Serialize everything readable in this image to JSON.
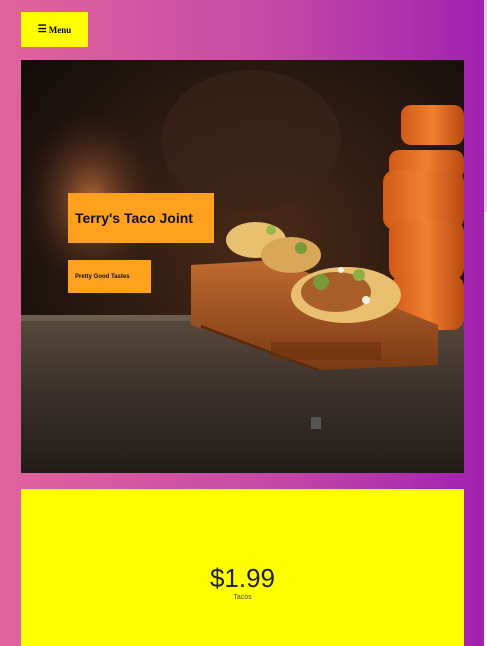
{
  "nav": {
    "menu_icon": "☰",
    "menu_label": "Menu"
  },
  "hero": {
    "title": "Terry's Taco Joint",
    "tagline": "Pretty Good Tastes",
    "image": "tacos-on-wooden-board-photo"
  },
  "product": {
    "price": "$1.99",
    "label": "Tacos"
  },
  "colors": {
    "gradient_start": "#e2649c",
    "gradient_end": "#a021b0",
    "menu_bg": "#ffff00",
    "hero_label_bg": "#ffa01e",
    "card_bg": "#ffff00"
  }
}
